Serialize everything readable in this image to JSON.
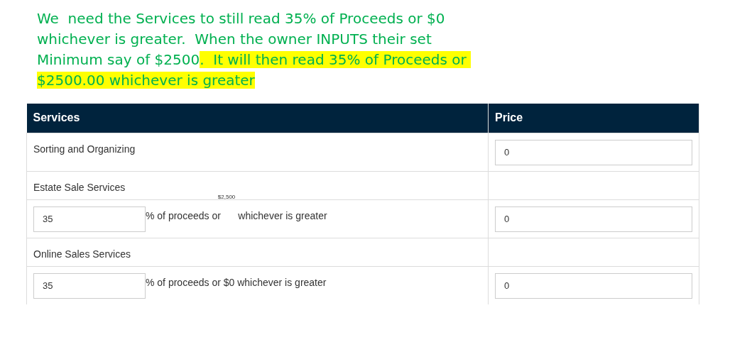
{
  "note": {
    "text": "We  need the Services to still read 35% of Proceeds or $0 whichever is greater.  When the owner INPUTS their set Minimum say of $2500",
    "highlighted": ".  It will then read 35% of Proceeds or $2500.00 whichever is greater"
  },
  "table": {
    "columns": [
      "Services",
      "Price"
    ],
    "rows": [
      {
        "kind": "item",
        "label": "Sorting and Organizing",
        "price": "0"
      },
      {
        "kind": "section",
        "label": "Estate Sale Services"
      },
      {
        "kind": "percent",
        "value": "35",
        "text_before": "% of proceeds or",
        "raised": "$2,500",
        "text_after": "whichever is greater",
        "price": "0"
      },
      {
        "kind": "section",
        "label": "Online Sales Services"
      },
      {
        "kind": "percent",
        "value": "35",
        "text_before": "% of proceeds or $0 whichever is greater",
        "price": "0"
      }
    ]
  }
}
